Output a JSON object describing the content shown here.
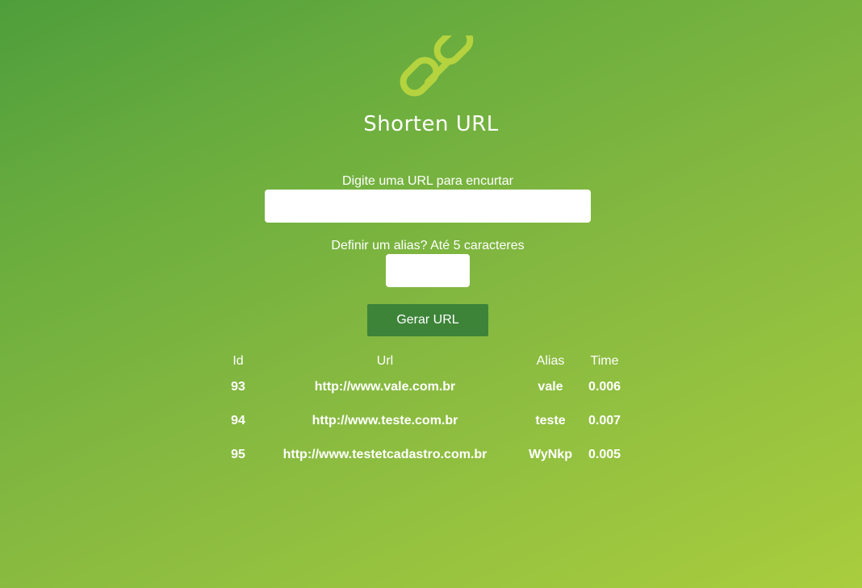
{
  "app": {
    "title": "Shorten URL",
    "logo_icon": "link-chain-icon",
    "logo_color": "#b5d33f"
  },
  "form": {
    "url_label": "Digite uma URL para encurtar",
    "url_value": "",
    "alias_label": "Definir um alias? Até 5 caracteres",
    "alias_value": "",
    "button_label": "Gerar URL",
    "button_color": "#3d8439"
  },
  "table": {
    "headers": {
      "id": "Id",
      "url": "Url",
      "alias": "Alias",
      "time": "Time"
    },
    "rows": [
      {
        "id": "93",
        "url": "http://www.vale.com.br",
        "alias": "vale",
        "time": "0.006"
      },
      {
        "id": "94",
        "url": "http://www.teste.com.br",
        "alias": "teste",
        "time": "0.007"
      },
      {
        "id": "95",
        "url": "http://www.testetcadastro.com.br",
        "alias": "WyNkp",
        "time": "0.005"
      }
    ]
  }
}
